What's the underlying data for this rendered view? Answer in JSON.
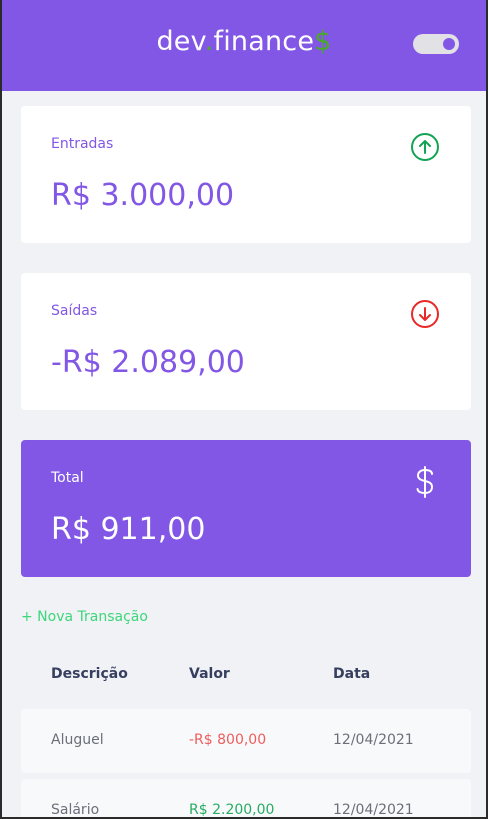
{
  "header": {
    "logo_prefix": "dev",
    "logo_dot": ".",
    "logo_name": "finance",
    "logo_suffix": "$"
  },
  "cards": {
    "income": {
      "label": "Entradas",
      "amount": "R$ 3.000,00",
      "icon": "arrow-up-circle-icon",
      "color": "#12a454"
    },
    "expense": {
      "label": "Saídas",
      "amount": "-R$ 2.089,00",
      "icon": "arrow-down-circle-icon",
      "color": "#e92929"
    },
    "total": {
      "label": "Total",
      "amount": "R$ 911,00",
      "icon": "dollar-icon",
      "color": "#8257e5"
    }
  },
  "new_transaction": "+ Nova Transação",
  "table": {
    "headers": [
      "Descrição",
      "Valor",
      "Data"
    ],
    "rows": [
      {
        "description": "Aluguel",
        "value": "-R$ 800,00",
        "date": "12/04/2021",
        "type": "expense"
      },
      {
        "description": "Salário",
        "value": "R$ 2.200,00",
        "date": "12/04/2021",
        "type": "income"
      }
    ]
  },
  "colors": {
    "brand": "#8257e5",
    "income": "#12a454",
    "expense": "#e92929",
    "link": "#3dd67a"
  }
}
